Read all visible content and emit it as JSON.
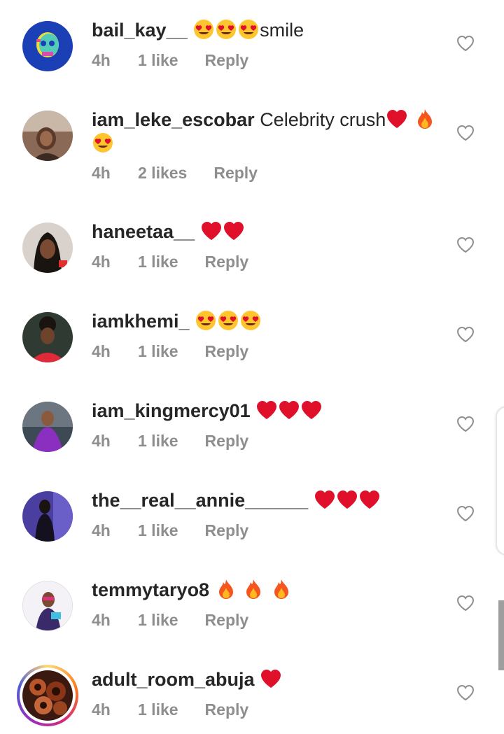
{
  "comments": [
    {
      "username": "bail_kay__",
      "text": "smile",
      "emojis": [
        "heart-eyes",
        "heart-eyes",
        "heart-eyes"
      ],
      "emoji_position": "before",
      "time": "4h",
      "likes": "1 like",
      "reply": "Reply",
      "avatar": "skull-avatar"
    },
    {
      "username": "iam_leke_escobar",
      "text": "Celebrity crush",
      "emojis": [
        "red-heart",
        "fire",
        "heart-eyes"
      ],
      "emoji_position": "after",
      "time": "4h",
      "likes": "2 likes",
      "reply": "Reply",
      "avatar": "person-avatar"
    },
    {
      "username": "haneetaa__",
      "text": "",
      "emojis": [
        "red-heart",
        "red-heart"
      ],
      "emoji_position": "after",
      "time": "4h",
      "likes": "1 like",
      "reply": "Reply",
      "avatar": "person-avatar"
    },
    {
      "username": "iamkhemi_",
      "text": "",
      "emojis": [
        "heart-eyes",
        "heart-eyes",
        "heart-eyes"
      ],
      "emoji_position": "after",
      "time": "4h",
      "likes": "1 like",
      "reply": "Reply",
      "avatar": "person-avatar"
    },
    {
      "username": "iam_kingmercy01",
      "text": "",
      "emojis": [
        "red-heart",
        "red-heart",
        "red-heart"
      ],
      "emoji_position": "after",
      "time": "4h",
      "likes": "1 like",
      "reply": "Reply",
      "avatar": "person-avatar"
    },
    {
      "username": "the__real__annie______",
      "text": "",
      "emojis": [
        "red-heart",
        "red-heart",
        "red-heart"
      ],
      "emoji_position": "after",
      "time": "4h",
      "likes": "1 like",
      "reply": "Reply",
      "avatar": "person-avatar"
    },
    {
      "username": "temmytaryo8",
      "text": "",
      "emojis": [
        "fire",
        "fire",
        "fire"
      ],
      "emoji_position": "after",
      "time": "4h",
      "likes": "1 like",
      "reply": "Reply",
      "avatar": "person-avatar"
    },
    {
      "username": "adult_room_abuja",
      "text": "",
      "emojis": [
        "red-heart"
      ],
      "emoji_position": "after",
      "time": "4h",
      "likes": "1 like",
      "reply": "Reply",
      "avatar": "story-ring-avatar"
    }
  ],
  "icons": {
    "like": "heart-outline-icon"
  },
  "colors": {
    "username": "#262626",
    "meta": "#8e8e8e",
    "heart_outline": "#8e8e8e",
    "red_heart": "#e0102a",
    "emoji_face": "#ffc52e"
  }
}
